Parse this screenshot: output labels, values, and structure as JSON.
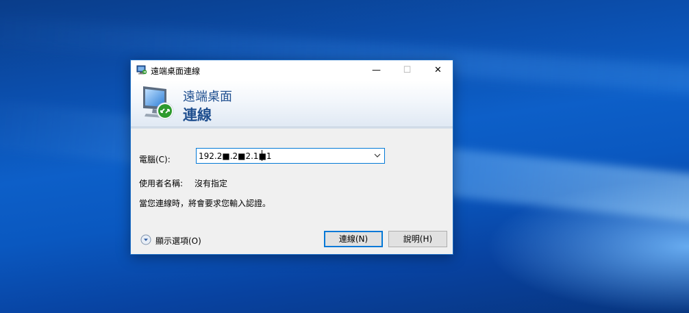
{
  "window": {
    "title": "遠端桌面連線",
    "controls": {
      "minimize": "—",
      "maximize": "☐",
      "close": "✕"
    }
  },
  "banner": {
    "line1": "遠端桌面",
    "line2": "連線"
  },
  "form": {
    "computer_label": "電腦(C):",
    "computer_value": "192.2■.2■2.1■1",
    "username_label": "使用者名稱:",
    "username_value": "沒有指定",
    "credentials_note": "當您連線時，將會要求您輸入認證。"
  },
  "footer": {
    "show_options": "顯示選項(O)",
    "connect_button": "連線(N)",
    "help_button": "說明(H)"
  },
  "colors": {
    "accent": "#0078d7",
    "banner_text": "#1f4f8f",
    "desktop": "#0b4fae"
  },
  "icons": {
    "title": "remote-desktop-icon",
    "banner": "remote-desktop-monitor-icon",
    "combo": "chevron-down-icon",
    "options": "expand-circle-icon"
  }
}
